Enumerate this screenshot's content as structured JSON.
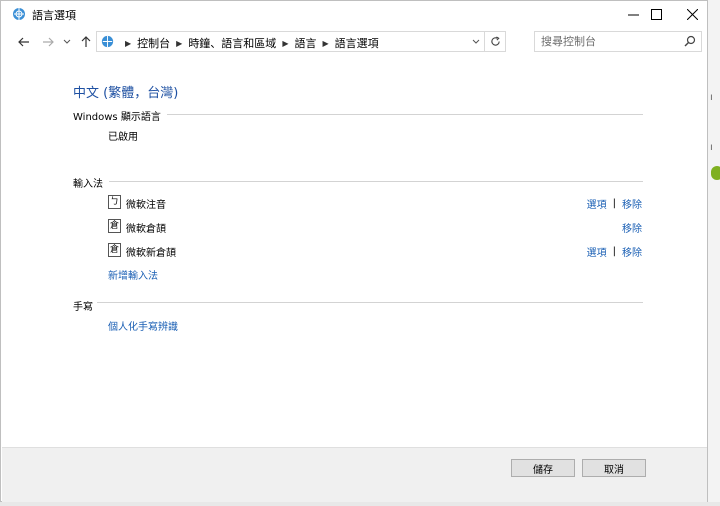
{
  "window": {
    "title": "語言選項",
    "minimize_icon": "minimize-icon",
    "maximize_icon": "maximize-icon",
    "close_icon": "close-icon"
  },
  "nav": {
    "back_icon": "back-arrow-icon",
    "forward_icon": "forward-arrow-icon",
    "recent_icon": "recent-pages-chevron-icon",
    "up_icon": "up-arrow-icon"
  },
  "address": {
    "breadcrumbs": [
      "控制台",
      "時鐘、語言和區域",
      "語言",
      "語言選項"
    ]
  },
  "search": {
    "placeholder": "搜尋控制台"
  },
  "language_heading": "中文 (繁體，台灣)",
  "display_language": {
    "section_label": "Windows 顯示語言",
    "status": "已啟用"
  },
  "input_methods": {
    "section_label": "輸入法",
    "items": [
      {
        "icon_glyph": "ㄅ",
        "name": "微軟注音",
        "options_label": "選項",
        "remove_label": "移除"
      },
      {
        "icon_glyph": "倉",
        "name": "微軟倉頡",
        "remove_label": "移除"
      },
      {
        "icon_glyph": "倉",
        "name": "微軟新倉頡",
        "options_label": "選項",
        "remove_label": "移除"
      }
    ],
    "add_label": "新增輸入法"
  },
  "handwriting": {
    "section_label": "手寫",
    "personalize_label": "個人化手寫辨識"
  },
  "footer": {
    "save_label": "儲存",
    "cancel_label": "取消"
  },
  "colors": {
    "link": "#1a5fb4",
    "heading": "#1e50a2"
  }
}
